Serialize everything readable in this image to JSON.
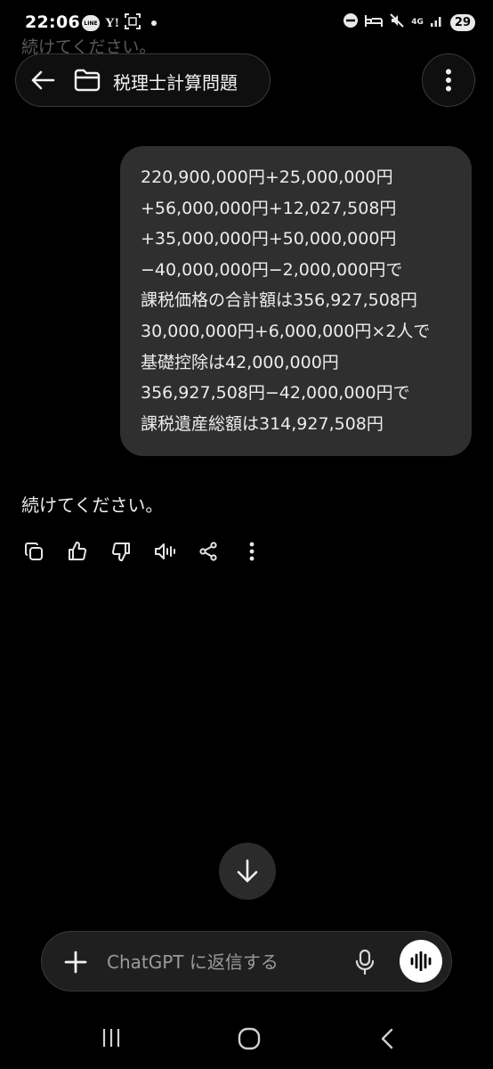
{
  "status_bar": {
    "time": "22:06",
    "line_icon_label": "LINE",
    "yahoo_icon_label": "Y!",
    "network_label": "4G",
    "battery_level": "29"
  },
  "ghost_text": "続けてください。",
  "header": {
    "title": "税理士計算問題"
  },
  "user_message": {
    "lines": [
      "220,900,000円+25,000,000円",
      "+56,000,000円+12,027,508円",
      "+35,000,000円+50,000,000円",
      "−40,000,000円−2,000,000円で",
      "課税価格の合計額は356,927,508円",
      "30,000,000円+6,000,000円×2人で",
      "基礎控除は42,000,000円",
      "356,927,508円−42,000,000円で",
      "課税遺産総額は314,927,508円"
    ]
  },
  "assistant_message": {
    "text": "続けてください。"
  },
  "composer": {
    "placeholder": "ChatGPT に返信する"
  },
  "icons": {
    "back": "arrow-left-icon",
    "folder": "folder-icon",
    "menu": "more-vertical-icon",
    "copy": "copy-icon",
    "thumbs_up": "thumbs-up-icon",
    "thumbs_down": "thumbs-down-icon",
    "read_aloud": "speaker-icon",
    "share": "share-icon",
    "more": "more-vertical-icon",
    "scroll_down": "arrow-down-icon",
    "plus": "plus-icon",
    "mic": "microphone-icon",
    "voice": "voice-waveform-icon"
  },
  "colors": {
    "background": "#000000",
    "bubble": "#2f2f2f",
    "composer": "#1f1f1f",
    "text": "#ececec",
    "placeholder": "#9b9b9b"
  }
}
